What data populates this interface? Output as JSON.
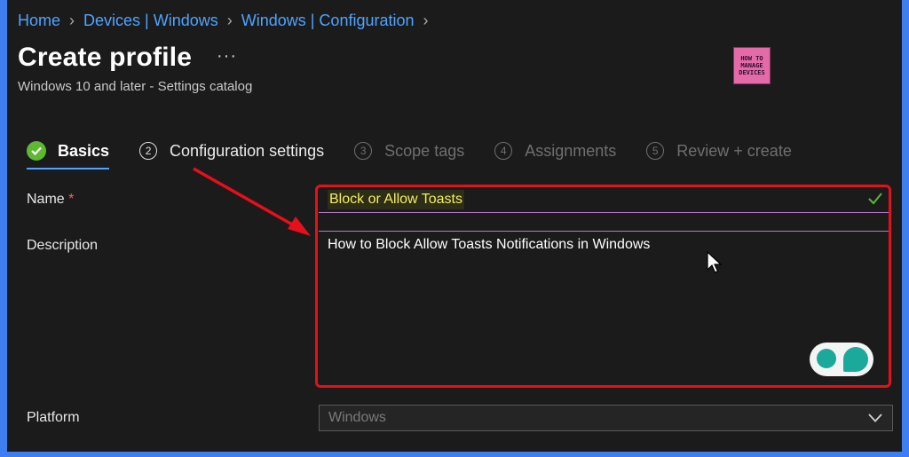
{
  "breadcrumb": {
    "items": [
      "Home",
      "Devices | Windows",
      "Windows | Configuration"
    ]
  },
  "header": {
    "title": "Create profile",
    "more": "···",
    "subtitle": "Windows 10 and later - Settings catalog"
  },
  "logo": {
    "line1": "HOW TO",
    "line2": "MANAGE",
    "line3": "DEVICES"
  },
  "steps": [
    {
      "number": "",
      "label": "Basics",
      "state": "completed"
    },
    {
      "number": "2",
      "label": "Configuration settings",
      "state": "current"
    },
    {
      "number": "3",
      "label": "Scope tags",
      "state": "disabled"
    },
    {
      "number": "4",
      "label": "Assignments",
      "state": "disabled"
    },
    {
      "number": "5",
      "label": "Review + create",
      "state": "disabled"
    }
  ],
  "form": {
    "name_label": "Name",
    "required_mark": "*",
    "name_value": "Block or Allow Toasts",
    "description_label": "Description",
    "description_value": "How to Block Allow Toasts Notifications in Windows",
    "platform_label": "Platform",
    "platform_value": "Windows"
  },
  "colors": {
    "accent": "#4ea4ff",
    "success": "#5fb832",
    "highlight_box": "#e4101b",
    "background": "#1b1b1b"
  }
}
